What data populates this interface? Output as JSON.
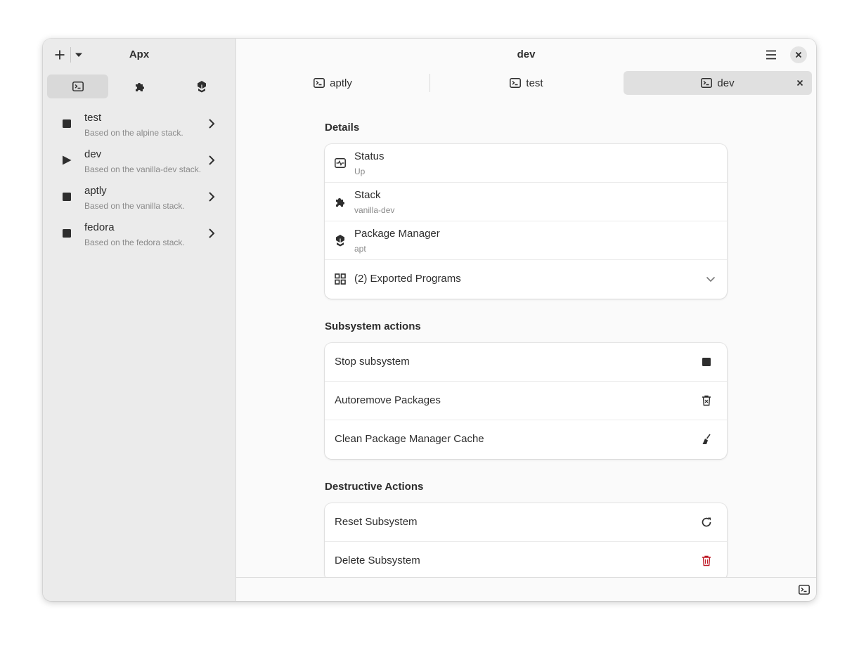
{
  "sidebar": {
    "title": "Apx",
    "view_switcher": [
      {
        "icon": "terminal-icon",
        "active": true
      },
      {
        "icon": "puzzle-icon",
        "active": false
      },
      {
        "icon": "package-icon",
        "active": false
      }
    ],
    "items": [
      {
        "name": "test",
        "subtitle": "Based on the alpine stack.",
        "status": "stopped"
      },
      {
        "name": "dev",
        "subtitle": "Based on the vanilla-dev stack.",
        "status": "running"
      },
      {
        "name": "aptly",
        "subtitle": "Based on the vanilla stack.",
        "status": "stopped"
      },
      {
        "name": "fedora",
        "subtitle": "Based on the fedora stack.",
        "status": "stopped"
      }
    ]
  },
  "header": {
    "title": "dev"
  },
  "tabs": [
    {
      "label": "aptly",
      "active": false
    },
    {
      "label": "test",
      "active": false
    },
    {
      "label": "dev",
      "active": true
    }
  ],
  "details": {
    "title": "Details",
    "rows": [
      {
        "title": "Status",
        "subtitle": "Up",
        "icon": "status-monitor-icon"
      },
      {
        "title": "Stack",
        "subtitle": "vanilla-dev",
        "icon": "puzzle-icon"
      },
      {
        "title": "Package Manager",
        "subtitle": "apt",
        "icon": "package-icon"
      }
    ],
    "exported": {
      "label": "(2) Exported Programs",
      "icon": "grid-icon"
    }
  },
  "subsystem_actions": {
    "title": "Subsystem actions",
    "rows": [
      {
        "label": "Stop subsystem",
        "icon": "stop-icon"
      },
      {
        "label": "Autoremove Packages",
        "icon": "trash-x-icon"
      },
      {
        "label": "Clean Package Manager Cache",
        "icon": "broom-icon"
      }
    ]
  },
  "destructive_actions": {
    "title": "Destructive Actions",
    "rows": [
      {
        "label": "Reset Subsystem",
        "icon": "reset-icon"
      },
      {
        "label": "Delete Subsystem",
        "icon": "delete-icon"
      }
    ]
  },
  "colors": {
    "accent_destructive": "#c01c28",
    "sidebar_bg": "#ebebeb",
    "content_bg": "#fafafa"
  }
}
